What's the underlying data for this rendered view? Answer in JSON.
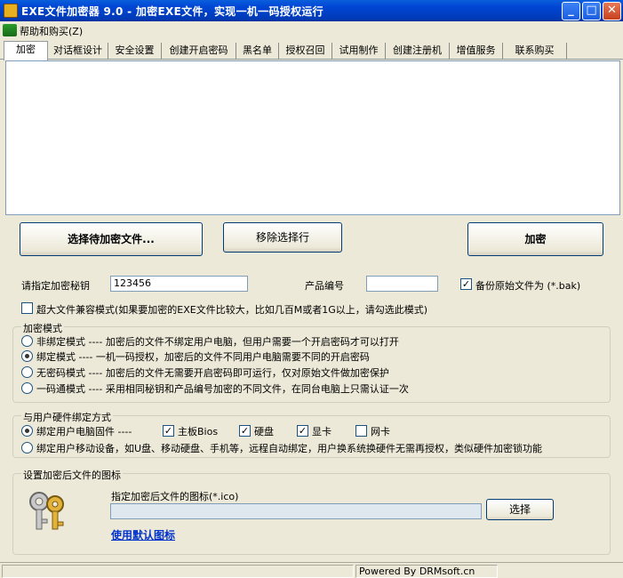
{
  "window": {
    "title": "EXE文件加密器 9.0 - 加密EXE文件，实现一机一码授权运行",
    "minimize": "_",
    "maximize": "□",
    "close": "✕"
  },
  "menu": {
    "help": "帮助和购买(Z)"
  },
  "tabs": [
    "加密",
    "对话框设计",
    "安全设置",
    "创建开启密码",
    "黑名单",
    "授权召回",
    "试用制作",
    "创建注册机",
    "增值服务",
    "联系购买"
  ],
  "buttons": {
    "select_file": "选择待加密文件...",
    "remove_row": "移除选择行",
    "encrypt": "加密",
    "browse": "选择"
  },
  "key": {
    "label": "请指定加密秘钥",
    "value": "123456"
  },
  "product": {
    "label": "产品编号",
    "value": ""
  },
  "backup": {
    "label": "备份原始文件为 (*.bak)",
    "checked": true
  },
  "compat": {
    "label": "超大文件兼容模式(如果要加密的EXE文件比较大，比如几百M或者1G以上，请勾选此模式)",
    "checked": false
  },
  "mode": {
    "title": "加密模式",
    "options": [
      {
        "label": "非绑定模式 ---- 加密后的文件不绑定用户电脑，但用户需要一个开启密码才可以打开",
        "selected": false
      },
      {
        "label": "绑定模式 ---- 一机一码授权，加密后的文件不同用户电脑需要不同的开启密码",
        "selected": true
      },
      {
        "label": "无密码模式 ---- 加密后的文件无需要开启密码即可运行，仅对原始文件做加密保护",
        "selected": false
      },
      {
        "label": "一码通模式 ---- 采用相同秘钥和产品编号加密的不同文件，在同台电脑上只需认证一次",
        "selected": false
      }
    ]
  },
  "hw": {
    "title": "与用户硬件绑定方式",
    "fixed_label": "绑定用户电脑固件 ----",
    "fixed_selected": true,
    "items": [
      {
        "label": "主板Bios",
        "checked": true
      },
      {
        "label": "硬盘",
        "checked": true
      },
      {
        "label": "显卡",
        "checked": true
      },
      {
        "label": "网卡",
        "checked": false
      }
    ],
    "mobile_label": "绑定用户移动设备，如U盘、移动硬盘、手机等，远程自动绑定，用户换系统换硬件无需再授权，类似硬件加密锁功能",
    "mobile_selected": false
  },
  "icon_section": {
    "title": "设置加密后文件的图标",
    "prompt": "指定加密后文件的图标(*.ico)",
    "path": "",
    "default_link": "使用默认图标"
  },
  "status": {
    "powered": "Powered By DRMsoft.cn"
  }
}
